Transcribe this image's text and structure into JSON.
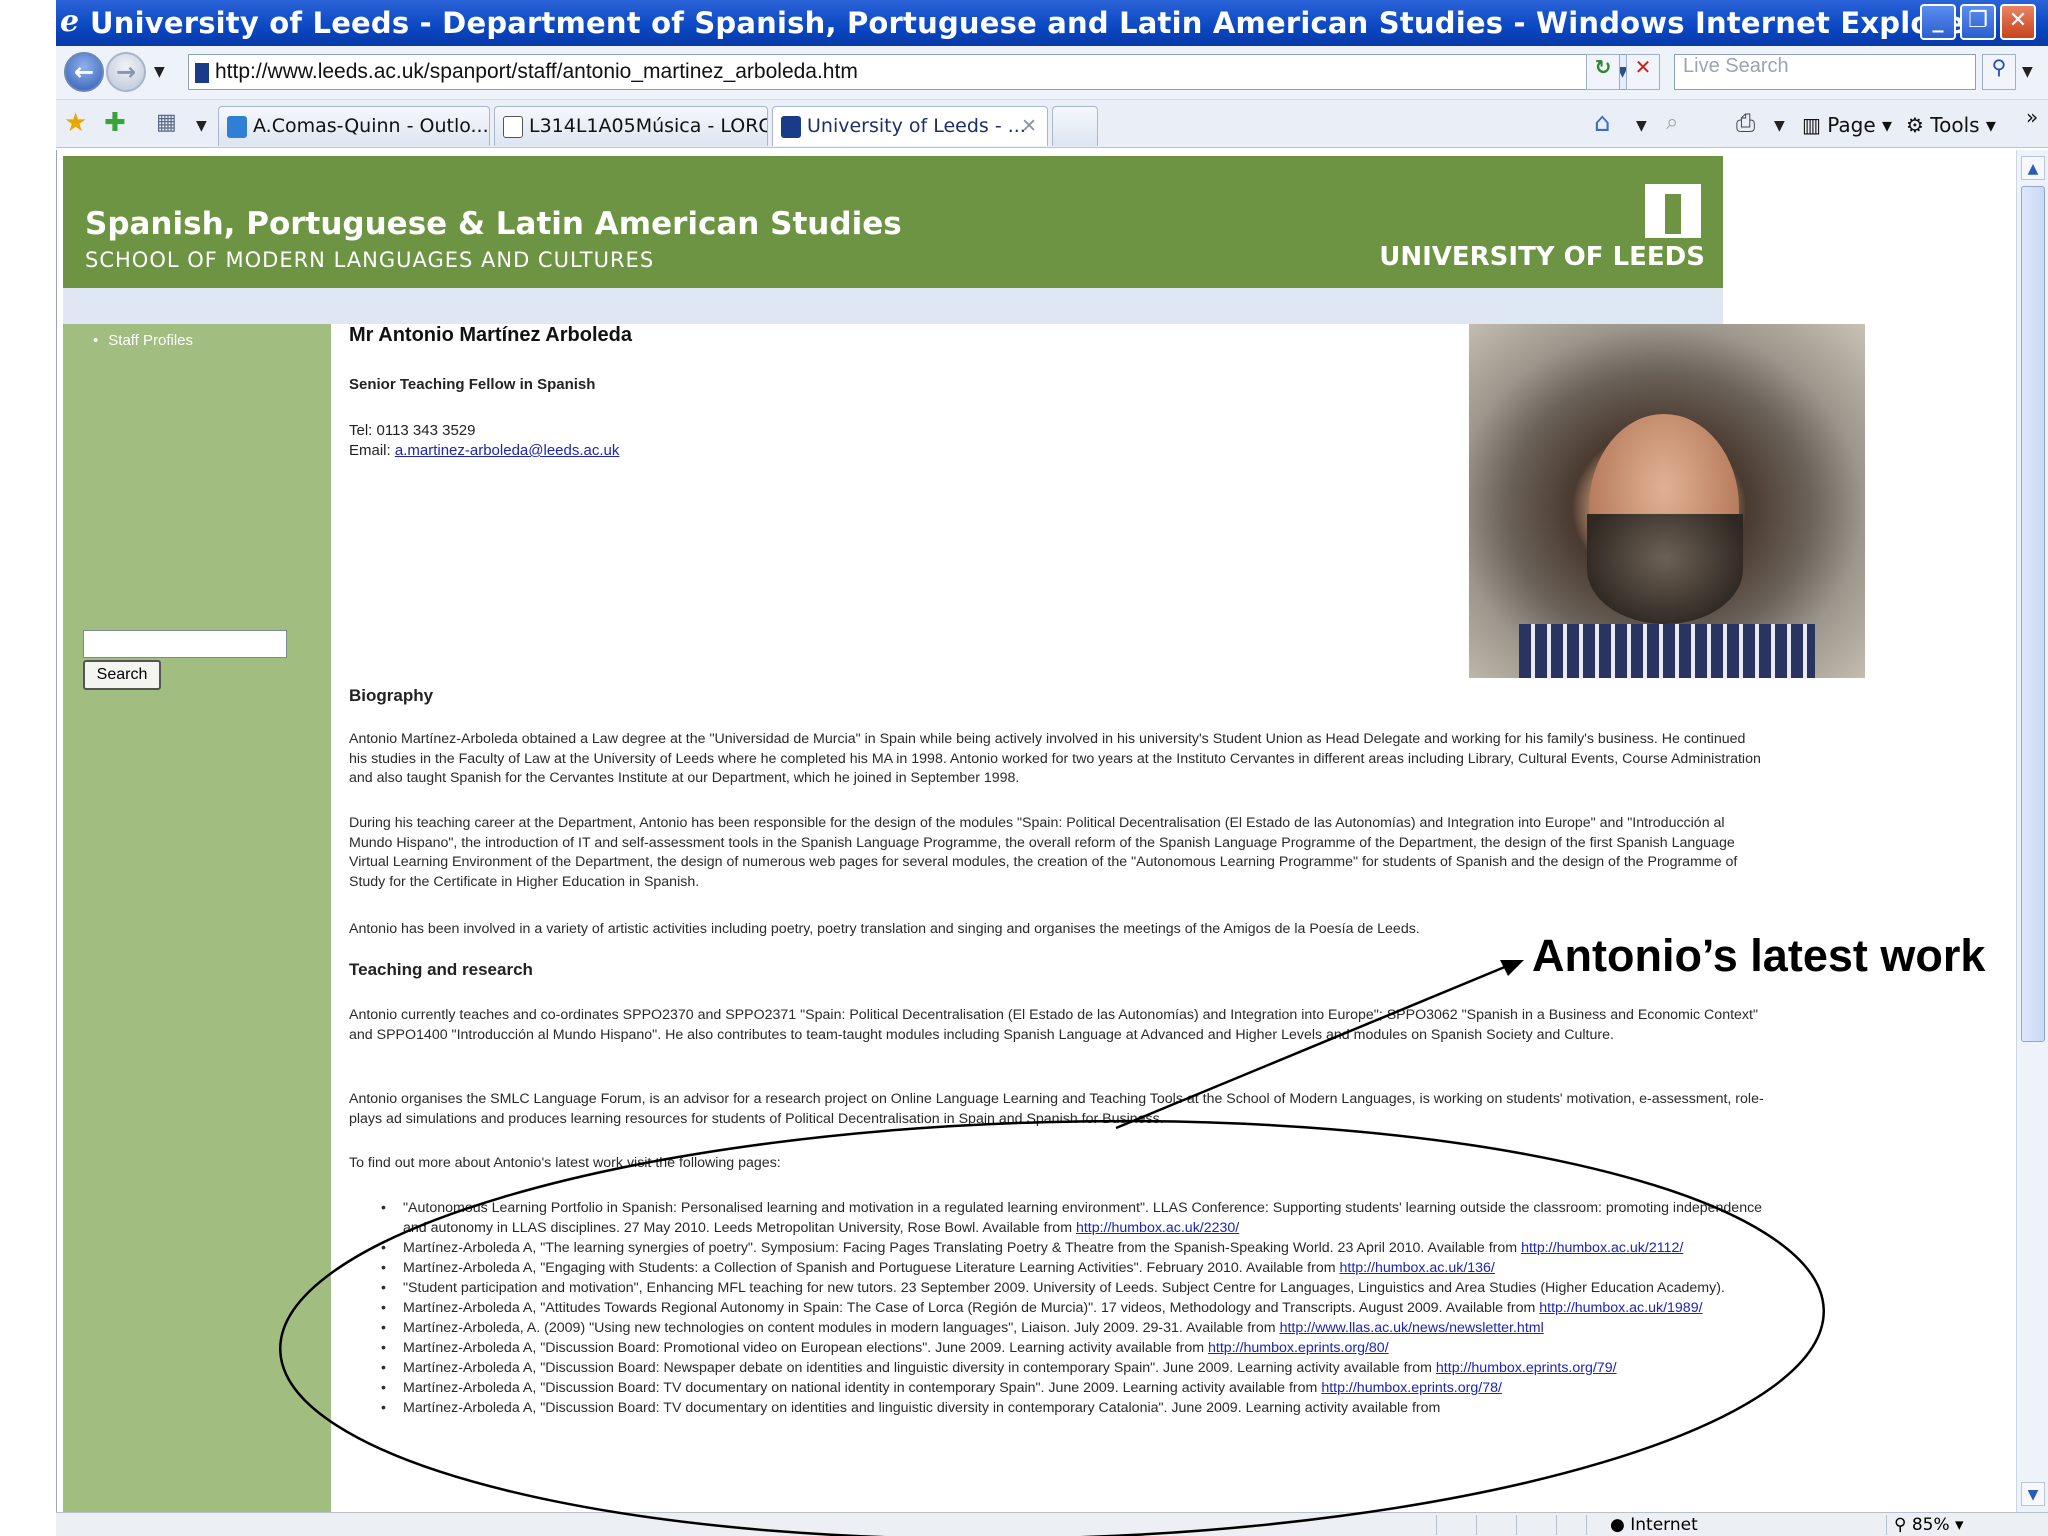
{
  "window": {
    "title": "University of Leeds - Department of Spanish, Portuguese and Latin American Studies - Windows Internet Explorer provided by T...",
    "buttons": {
      "minimize": "_",
      "restore": "❐",
      "close": "✕"
    }
  },
  "addressbar": {
    "url": "http://www.leeds.ac.uk/spanport/staff/antonio_martinez_arboleda.htm",
    "search_placeholder": "Live Search"
  },
  "tabs": [
    {
      "label": "A.Comas-Quinn - Outlo...",
      "active": false
    },
    {
      "label": "L314L1A05Música - LORO",
      "active": false
    },
    {
      "label": "University of Leeds - ...",
      "active": true
    }
  ],
  "commandbar": {
    "page": "Page",
    "tools": "Tools",
    "more": "»"
  },
  "banner": {
    "department": "Spanish, Portuguese & Latin American Studies",
    "school": "SCHOOL OF MODERN LANGUAGES AND CULTURES",
    "university": "UNIVERSITY OF LEEDS",
    "color": "#6c9443"
  },
  "sidebar": {
    "nav": [
      {
        "label": "Staff Profiles"
      }
    ],
    "search_button": "Search"
  },
  "profile": {
    "name": "Mr Antonio Martínez Arboleda",
    "role": "Senior Teaching Fellow in Spanish",
    "tel": "Tel: 0113 343 3529",
    "email_label": "Email:",
    "email": "a.martinez-arboleda@leeds.ac.uk"
  },
  "sections": {
    "biography": "Biography",
    "teaching": "Teaching and research"
  },
  "paragraphs": {
    "bio1": "Antonio Martínez-Arboleda obtained a Law degree at the \"Universidad de Murcia\" in Spain while being actively involved in his university's Student Union as Head Delegate and working for his family's business. He continued his studies in the Faculty of Law at the University of Leeds where he completed his MA in 1998. Antonio worked for two years at the Instituto Cervantes in different areas including Library, Cultural Events, Course Administration and also taught Spanish for the Cervantes Institute at our Department, which he joined in September 1998.",
    "bio2": "During his teaching career at the Department, Antonio has been responsible for the design of the modules \"Spain: Political Decentralisation (El Estado de las Autonomías) and Integration into Europe\" and \"Introducción al Mundo Hispano\", the introduction of IT and self-assessment tools in the Spanish Language Programme, the overall reform of the Spanish Language Programme of the Department, the design of the first Spanish Language Virtual Learning Environment of the Department, the design of numerous web pages for several modules, the creation of the \"Autonomous Learning Programme\" for students of Spanish and the design of the Programme of Study for the Certificate in Higher Education in Spanish.",
    "bio3": "Antonio has been involved in a variety of artistic activities including poetry, poetry translation and singing and organises the meetings of the Amigos de la Poesía de Leeds.",
    "teach1": "Antonio currently teaches and co-ordinates SPPO2370 and SPPO2371 \"Spain: Political Decentralisation (El Estado de las Autonomías) and Integration into Europe\"; SPPO3062 \"Spanish in a Business and Economic Context\" and SPPO1400 \"Introducción al Mundo Hispano\". He also contributes to team-taught modules including Spanish Language at Advanced and Higher Levels and modules on Spanish Society and Culture.",
    "teach2": "Antonio organises the SMLC Language Forum, is an advisor for a research project on Online Language Learning and Teaching Tools at the School of Modern Languages, is working on students' motivation, e-assessment, role-plays ad simulations and produces learning resources for students of Political Decentralisation in Spain and Spanish for Business.",
    "findout": "To find out more about Antonio's latest work visit the following pages:"
  },
  "references": [
    {
      "text": "\"Autonomous Learning Portfolio in Spanish: Personalised learning and motivation in a regulated learning environment\". LLAS Conference: Supporting students' learning outside the classroom: promoting independence and autonomy in LLAS disciplines. 27 May 2010. Leeds Metropolitan University, Rose Bowl. Available from",
      "link": "http://humbox.ac.uk/2230/"
    },
    {
      "text": "Martínez-Arboleda A, \"The learning synergies of poetry\". Symposium: Facing Pages Translating Poetry & Theatre from the Spanish-Speaking World. 23 April 2010. Available from",
      "link": "http://humbox.ac.uk/2112/"
    },
    {
      "text": "Martínez-Arboleda A, \"Engaging with Students: a Collection of Spanish and Portuguese Literature Learning Activities\". February 2010. Available from",
      "link": "http://humbox.ac.uk/136/"
    },
    {
      "text": "\"Student participation and motivation\", Enhancing MFL teaching for new tutors. 23 September 2009. University of Leeds. Subject Centre for Languages, Linguistics and Area Studies (Higher Education Academy).",
      "link": ""
    },
    {
      "text": "Martínez-Arboleda A, \"Attitudes Towards Regional Autonomy in Spain: The Case of Lorca (Región de Murcia)\". 17 videos, Methodology and Transcripts. August 2009. Available from",
      "link": "http://humbox.ac.uk/1989/"
    },
    {
      "text": "Martínez-Arboleda, A. (2009) \"Using new technologies on content modules in modern languages\", Liaison. July 2009. 29-31. Available from",
      "link": "http://www.llas.ac.uk/news/newsletter.html"
    },
    {
      "text": "Martínez-Arboleda A, \"Discussion Board: Promotional video on European elections\". June 2009. Learning activity available from",
      "link": "http://humbox.eprints.org/80/"
    },
    {
      "text": "Martínez-Arboleda A, \"Discussion Board: Newspaper debate on identities and linguistic diversity in contemporary Spain\". June 2009. Learning activity available from",
      "link": "http://humbox.eprints.org/79/"
    },
    {
      "text": "Martínez-Arboleda A, \"Discussion Board: TV documentary on national identity in contemporary Spain\". June 2009. Learning activity available from",
      "link": "http://humbox.eprints.org/78/"
    },
    {
      "text": "Martínez-Arboleda A, \"Discussion Board: TV documentary on identities and linguistic diversity in contemporary Catalonia\". June 2009. Learning activity available from",
      "link": ""
    }
  ],
  "annotation": {
    "label": "Antonio’s latest work"
  },
  "statusbar": {
    "zone": "Internet",
    "zoom": "85%"
  }
}
